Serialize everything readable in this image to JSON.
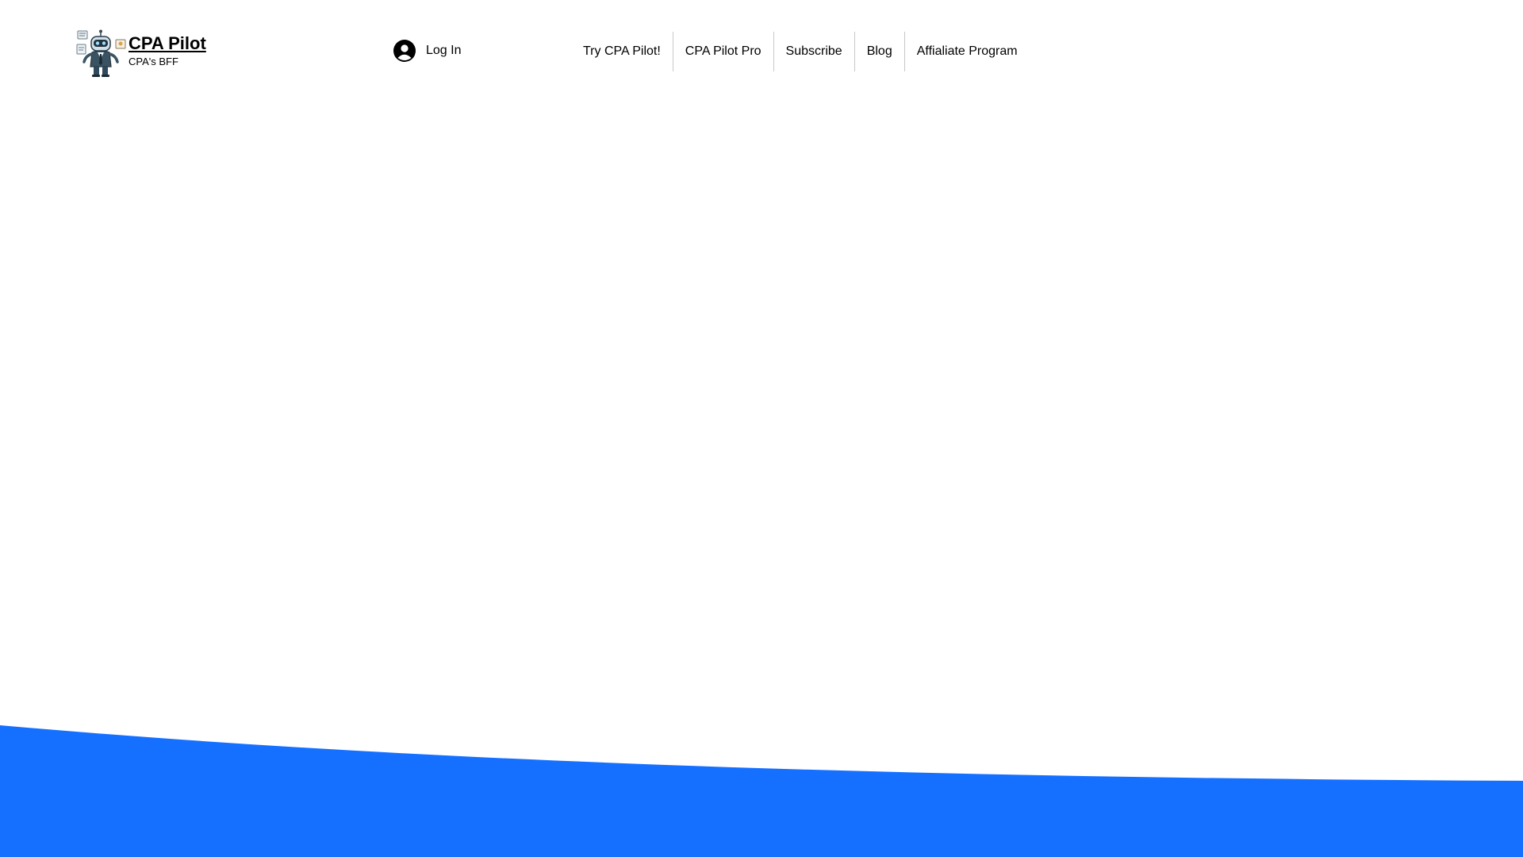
{
  "brand": {
    "title": "CPA Pilot",
    "tagline": "CPA's BFF",
    "logo_icon": "robot-mascot-icon"
  },
  "header": {
    "login": {
      "label": "Log In",
      "icon": "user-avatar-icon"
    },
    "nav": [
      {
        "label": "Try CPA Pilot!"
      },
      {
        "label": "CPA Pilot Pro"
      },
      {
        "label": "Subscribe"
      },
      {
        "label": "Blog"
      },
      {
        "label": "Affialiate Program"
      }
    ]
  },
  "colors": {
    "accent_blue": "#1570ff",
    "background": "#ffffff",
    "text": "#000000",
    "divider": "#c8c8c8"
  }
}
